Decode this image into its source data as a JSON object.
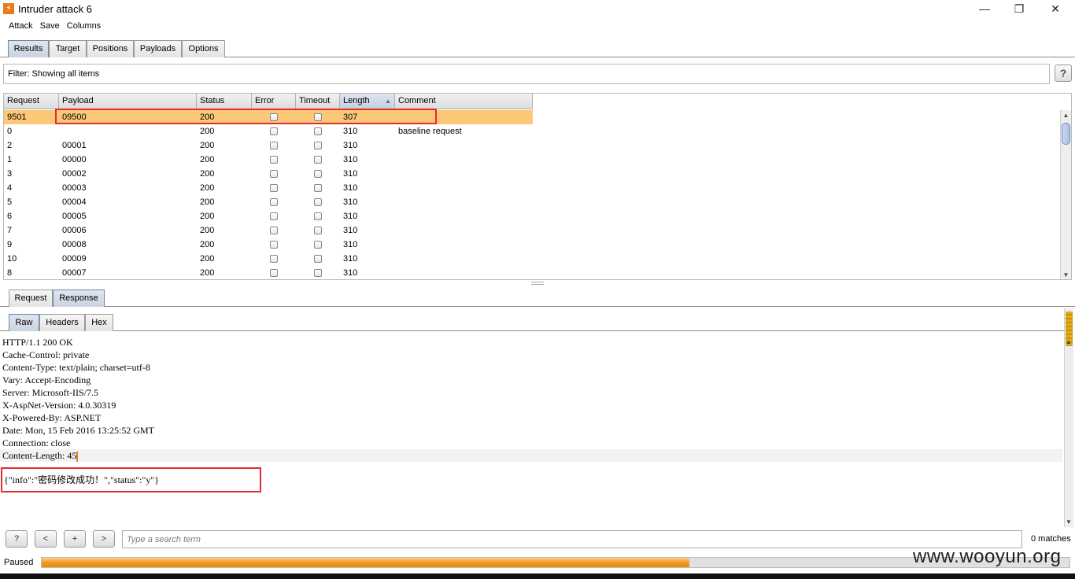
{
  "window": {
    "title": "Intruder attack 6",
    "minimize": "—",
    "restore": "❐",
    "close": "✕"
  },
  "menu": [
    "Attack",
    "Save",
    "Columns"
  ],
  "main_tabs": [
    {
      "label": "Results",
      "active": true
    },
    {
      "label": "Target"
    },
    {
      "label": "Positions"
    },
    {
      "label": "Payloads"
    },
    {
      "label": "Options"
    }
  ],
  "filter": {
    "text": "Filter: Showing all items"
  },
  "help_label": "?",
  "table": {
    "columns": [
      "Request",
      "Payload",
      "Status",
      "Error",
      "Timeout",
      "Length",
      "Comment"
    ],
    "sort_indicator": "▲",
    "rows": [
      {
        "request": "9501",
        "payload": "09500",
        "status": "200",
        "length": "307",
        "comment": "",
        "selected": true
      },
      {
        "request": "0",
        "payload": "",
        "status": "200",
        "length": "310",
        "comment": "baseline request"
      },
      {
        "request": "2",
        "payload": "00001",
        "status": "200",
        "length": "310",
        "comment": ""
      },
      {
        "request": "1",
        "payload": "00000",
        "status": "200",
        "length": "310",
        "comment": ""
      },
      {
        "request": "3",
        "payload": "00002",
        "status": "200",
        "length": "310",
        "comment": ""
      },
      {
        "request": "4",
        "payload": "00003",
        "status": "200",
        "length": "310",
        "comment": ""
      },
      {
        "request": "5",
        "payload": "00004",
        "status": "200",
        "length": "310",
        "comment": ""
      },
      {
        "request": "6",
        "payload": "00005",
        "status": "200",
        "length": "310",
        "comment": ""
      },
      {
        "request": "7",
        "payload": "00006",
        "status": "200",
        "length": "310",
        "comment": ""
      },
      {
        "request": "9",
        "payload": "00008",
        "status": "200",
        "length": "310",
        "comment": ""
      },
      {
        "request": "10",
        "payload": "00009",
        "status": "200",
        "length": "310",
        "comment": ""
      },
      {
        "request": "8",
        "payload": "00007",
        "status": "200",
        "length": "310",
        "comment": ""
      }
    ]
  },
  "msg_tabs": [
    {
      "label": "Request"
    },
    {
      "label": "Response",
      "active": true
    }
  ],
  "view_tabs": [
    {
      "label": "Raw",
      "active": true
    },
    {
      "label": "Headers"
    },
    {
      "label": "Hex"
    }
  ],
  "response": {
    "lines": [
      "HTTP/1.1 200 OK",
      "Cache-Control: private",
      "Content-Type: text/plain; charset=utf-8",
      "Vary: Accept-Encoding",
      "Server: Microsoft-IIS/7.5",
      "X-AspNet-Version: 4.0.30319",
      "X-Powered-By: ASP.NET",
      "Date: Mon, 15 Feb 2016 13:25:52 GMT",
      "Connection: close",
      "Content-Length: 45"
    ],
    "body": "{\"info\":\"密码修改成功！\",\"status\":\"y\"}"
  },
  "search": {
    "help": "?",
    "prev": "<",
    "add": "+",
    "next": ">",
    "placeholder": "Type a search term",
    "matches": "0 matches"
  },
  "status": {
    "label": "Paused",
    "progress_fraction": 0.63
  },
  "watermark": "www.wooyun.org",
  "colors": {
    "accent": "#e87a1c",
    "selected_row": "#fcc877",
    "highlight_box": "#e02d2d"
  }
}
